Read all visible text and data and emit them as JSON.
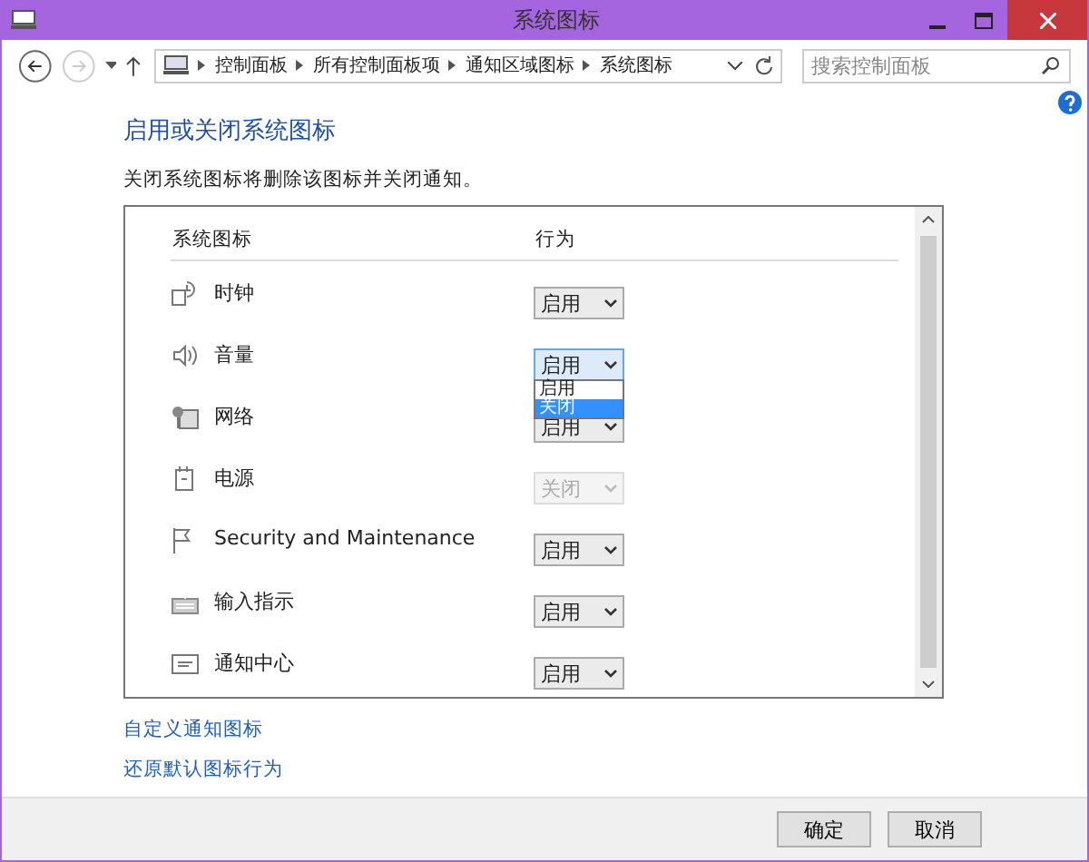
{
  "window": {
    "title": "系统图标"
  },
  "address": {
    "crumbs": [
      "控制面板",
      "所有控制面板项",
      "通知区域图标",
      "系统图标"
    ]
  },
  "search": {
    "placeholder": "搜索控制面板"
  },
  "heading": "启用或关闭系统图标",
  "description": "关闭系统图标将删除该图标并关闭通知。",
  "table": {
    "columns": [
      "系统图标",
      "行为"
    ],
    "rows": [
      {
        "name": "时钟",
        "behavior": "启用",
        "disabled": false,
        "expanded": false
      },
      {
        "name": "音量",
        "behavior": "启用",
        "disabled": false,
        "expanded": true,
        "options": [
          {
            "label": "启用",
            "selected": false
          },
          {
            "label": "关闭",
            "selected": true
          }
        ]
      },
      {
        "name": "网络",
        "behavior": "启用",
        "disabled": false,
        "expanded": false
      },
      {
        "name": "电源",
        "behavior": "关闭",
        "disabled": true,
        "expanded": false
      },
      {
        "name": "Security and Maintenance",
        "behavior": "启用",
        "disabled": false,
        "expanded": false
      },
      {
        "name": "输入指示",
        "behavior": "启用",
        "disabled": false,
        "expanded": false
      },
      {
        "name": "通知中心",
        "behavior": "启用",
        "disabled": false,
        "expanded": false
      }
    ]
  },
  "links": [
    "自定义通知图标",
    "还原默认图标行为"
  ],
  "buttons": [
    "确定",
    "取消"
  ]
}
